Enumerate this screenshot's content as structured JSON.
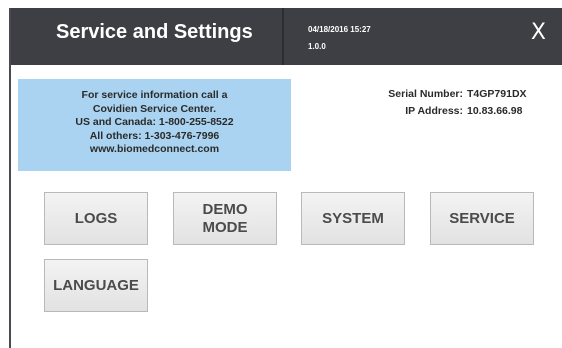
{
  "header": {
    "title": "Service and Settings",
    "date_time": "04/18/2016  15:27",
    "version": "1.0.0",
    "close_label": "X"
  },
  "info_box": {
    "lines": [
      "For service information call a",
      "Covidien Service Center.",
      "US and Canada: 1-800-255-8522",
      "All others: 1-303-476-7996",
      "www.biomedconnect.com"
    ]
  },
  "device": {
    "serial_label": "Serial Number:",
    "serial_value": "T4GP791DX",
    "ip_label": "IP Address:",
    "ip_value": "10.83.66.98"
  },
  "buttons": {
    "logs": "LOGS",
    "demo_mode": "DEMO\nMODE",
    "system": "SYSTEM",
    "service": "SERVICE",
    "language": "LANGUAGE"
  },
  "colors": {
    "header_bg": "#3e3f45",
    "info_box_bg": "#a9d3f0",
    "button_bg": "#ebebeb"
  }
}
